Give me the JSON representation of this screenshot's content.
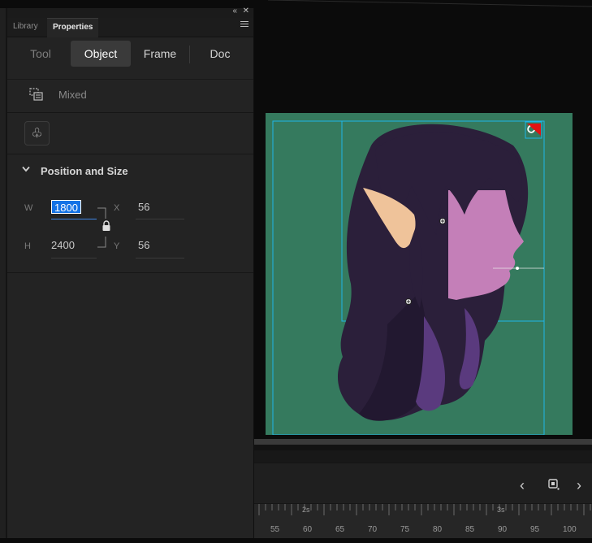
{
  "panel": {
    "tabs": [
      {
        "label": "Library"
      },
      {
        "label": "Properties"
      }
    ],
    "collapse_glyph": "«",
    "close_glyph": "✕"
  },
  "segments": {
    "tool": "Tool",
    "object": "Object",
    "frame": "Frame",
    "doc": "Doc",
    "selected": "Object"
  },
  "mixed": {
    "label": "Mixed",
    "icon": "mixed-selection-icon"
  },
  "symbol_button": {
    "icon": "club-icon",
    "glyph": "♧"
  },
  "position_size": {
    "title": "Position and Size",
    "w_label": "W",
    "w_value": "1800",
    "h_label": "H",
    "h_value": "2400",
    "x_label": "X",
    "x_value": "56",
    "y_label": "Y",
    "y_value": "56",
    "lock": "locked"
  },
  "timeline": {
    "prev_glyph": "‹",
    "next_glyph": "›",
    "time_markers": [
      "2s",
      "3s"
    ],
    "ticks": [
      "55",
      "60",
      "65",
      "70",
      "75",
      "80",
      "85",
      "90",
      "95",
      "100"
    ]
  },
  "colors": {
    "stage": "#357a5e",
    "selection": "#1fb6e8",
    "accent": "#1473e6",
    "hair": "#2b1f3a",
    "skin": "#c47fb8",
    "ear": "#efc39a",
    "badge": "#e01212"
  }
}
